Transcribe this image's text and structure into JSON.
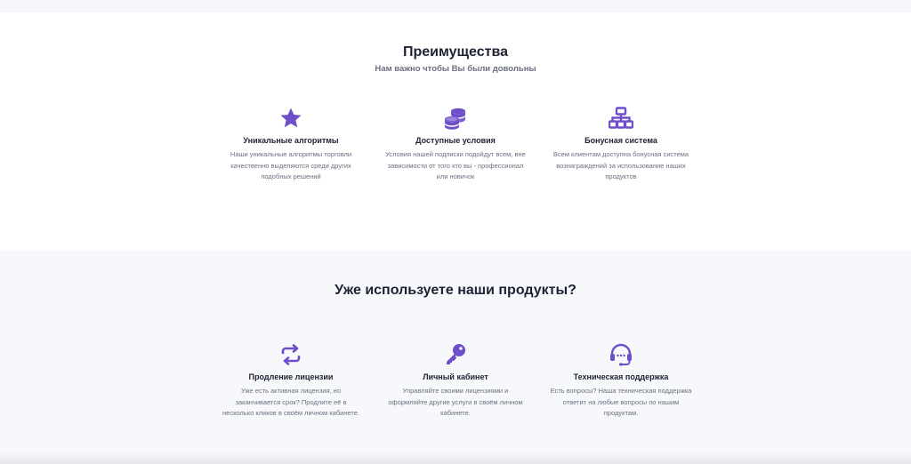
{
  "colors": {
    "accent": "#6e4fc9",
    "heading": "#1f2233",
    "muted": "#6b6f80",
    "section_bg": "#f7f8fc",
    "card_bg": "#ffffff"
  },
  "advantages": {
    "title": "Преимущества",
    "subtitle": "Нам важно чтобы Вы были довольны",
    "items": [
      {
        "icon": "star-icon",
        "title": "Уникальные алгоритмы",
        "lines": [
          "Наши уникальные алгоритмы торговли",
          "качественно выделяются среди других",
          "подобных решений"
        ]
      },
      {
        "icon": "coins-icon",
        "title": "Доступные условия",
        "lines": [
          "Условия нашей подписки подойдут всем, вне",
          "зависимости от того кто вы - профессионал",
          "или новичок"
        ]
      },
      {
        "icon": "network-icon",
        "title": "Бонусная система",
        "lines": [
          "Всем клиентам доступна бонусная система",
          "вознаграждений за использование наших",
          "продуктов"
        ]
      }
    ]
  },
  "products": {
    "title": "Уже используете наши продукты?",
    "items": [
      {
        "icon": "renew-icon",
        "title": "Продление лицензии",
        "lines": [
          "Уже есть активная лицензия, но",
          "заканчивается срок? Продлите её в",
          "несколько кликов в своём личном кабинете."
        ]
      },
      {
        "icon": "key-icon",
        "title": "Личный кабинет",
        "lines": [
          "Управляйте своими лицензиями и",
          "оформляйте другие услуги в своём личном",
          "кабинете."
        ]
      },
      {
        "icon": "headset-icon",
        "title": "Техническая поддержка",
        "lines": [
          "Есть вопросы? Наша техническая поддержка",
          "ответит на любые вопросы по нашим",
          "продуктам."
        ]
      }
    ]
  }
}
